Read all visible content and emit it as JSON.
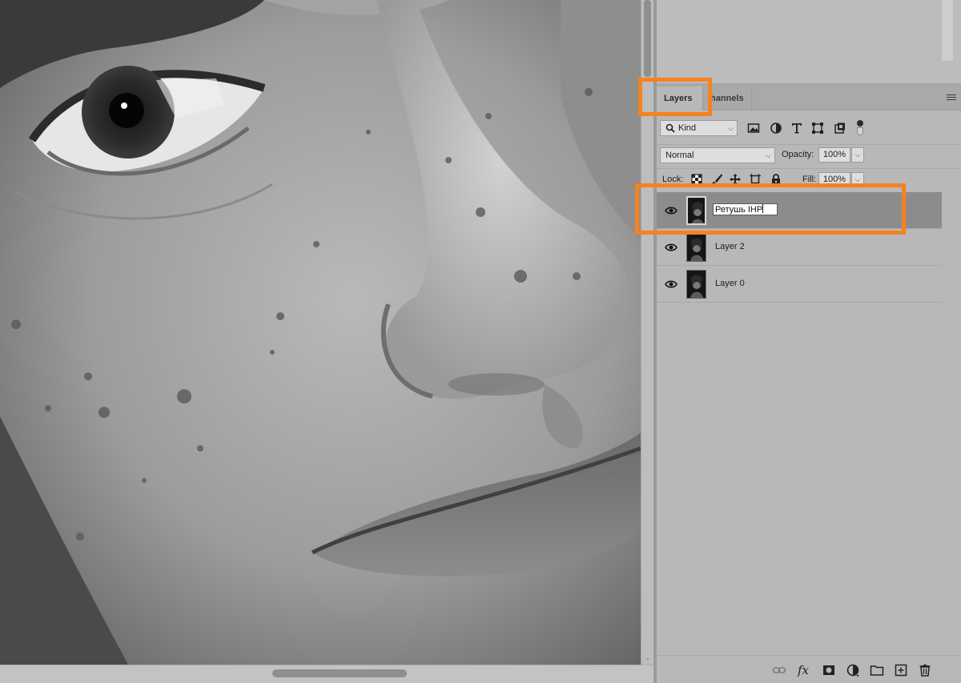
{
  "panel": {
    "tabs": [
      {
        "label": "Layers",
        "active": true
      },
      {
        "label": "Channels",
        "visible_label": "hannels",
        "active": false
      }
    ]
  },
  "filter": {
    "kind_label": "Kind",
    "filter_icons": [
      "image-filter-icon",
      "adjustment-filter-icon",
      "type-filter-icon",
      "shape-filter-icon",
      "smart-object-filter-icon"
    ]
  },
  "blend": {
    "mode": "Normal",
    "opacity_label": "Opacity:",
    "opacity_value": "100%"
  },
  "lock": {
    "label": "Lock:",
    "fill_label": "Fill:",
    "fill_value": "100%",
    "lock_icons": [
      "lock-transparent-pixels-icon",
      "lock-image-pixels-icon",
      "lock-position-icon",
      "lock-artboard-icon",
      "lock-all-icon"
    ]
  },
  "layers": [
    {
      "name": "Ретушь IHP",
      "visible": true,
      "selected": true,
      "editing": true
    },
    {
      "name": "Layer 2",
      "visible": true,
      "selected": false,
      "editing": false
    },
    {
      "name": "Layer 0",
      "visible": true,
      "selected": false,
      "editing": false
    }
  ],
  "bottom_icons": [
    "link-layers-icon",
    "fx-icon",
    "add-mask-icon",
    "new-adjustment-layer-icon",
    "new-group-icon",
    "new-layer-icon",
    "delete-layer-icon"
  ],
  "bottom_labels": {
    "fx": "fx"
  },
  "colors": {
    "highlight": "#f58220",
    "panel_bg": "#b8b8b8",
    "selected_row": "#8c8c8c"
  }
}
